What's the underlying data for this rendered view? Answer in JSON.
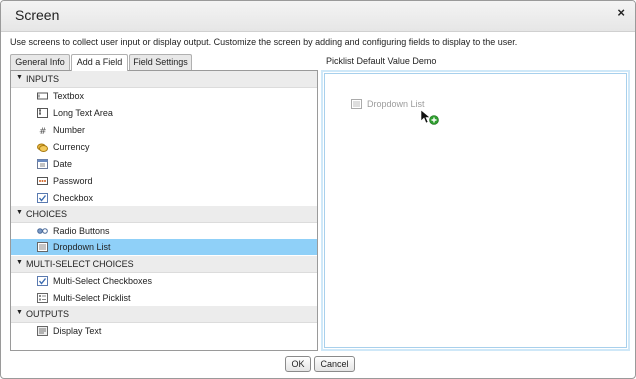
{
  "window": {
    "title": "Screen",
    "close_glyph": "×"
  },
  "description": "Use screens to collect user input or display output. Customize the screen by adding and configuring fields to display to the user.",
  "tabs": [
    {
      "label": "General Info"
    },
    {
      "label": "Add a Field",
      "active": true
    },
    {
      "label": "Field Settings"
    }
  ],
  "palette": {
    "groups": [
      {
        "label": "INPUTS",
        "items": [
          {
            "label": "Textbox",
            "icon": "textbox-icon"
          },
          {
            "label": "Long Text Area",
            "icon": "long-text-area-icon"
          },
          {
            "label": "Number",
            "icon": "number-icon"
          },
          {
            "label": "Currency",
            "icon": "currency-icon"
          },
          {
            "label": "Date",
            "icon": "date-icon"
          },
          {
            "label": "Password",
            "icon": "password-icon"
          },
          {
            "label": "Checkbox",
            "icon": "checkbox-icon"
          }
        ]
      },
      {
        "label": "CHOICES",
        "items": [
          {
            "label": "Radio Buttons",
            "icon": "radio-buttons-icon"
          },
          {
            "label": "Dropdown List",
            "icon": "dropdown-list-icon",
            "selected": true
          }
        ]
      },
      {
        "label": "MULTI-SELECT CHOICES",
        "items": [
          {
            "label": "Multi-Select Checkboxes",
            "icon": "multi-select-checkboxes-icon"
          },
          {
            "label": "Multi-Select Picklist",
            "icon": "multi-select-picklist-icon"
          }
        ]
      },
      {
        "label": "OUTPUTS",
        "items": [
          {
            "label": "Display Text",
            "icon": "display-text-icon"
          }
        ]
      }
    ]
  },
  "canvas": {
    "title": "Picklist Default Value Demo",
    "dragging_label": "Dropdown List"
  },
  "buttons": {
    "ok": "OK",
    "cancel": "Cancel"
  },
  "colors": {
    "selected_row": "#8fd0f8",
    "canvas_border": "#a8d0ec",
    "add_badge": "#2e9e2e"
  }
}
